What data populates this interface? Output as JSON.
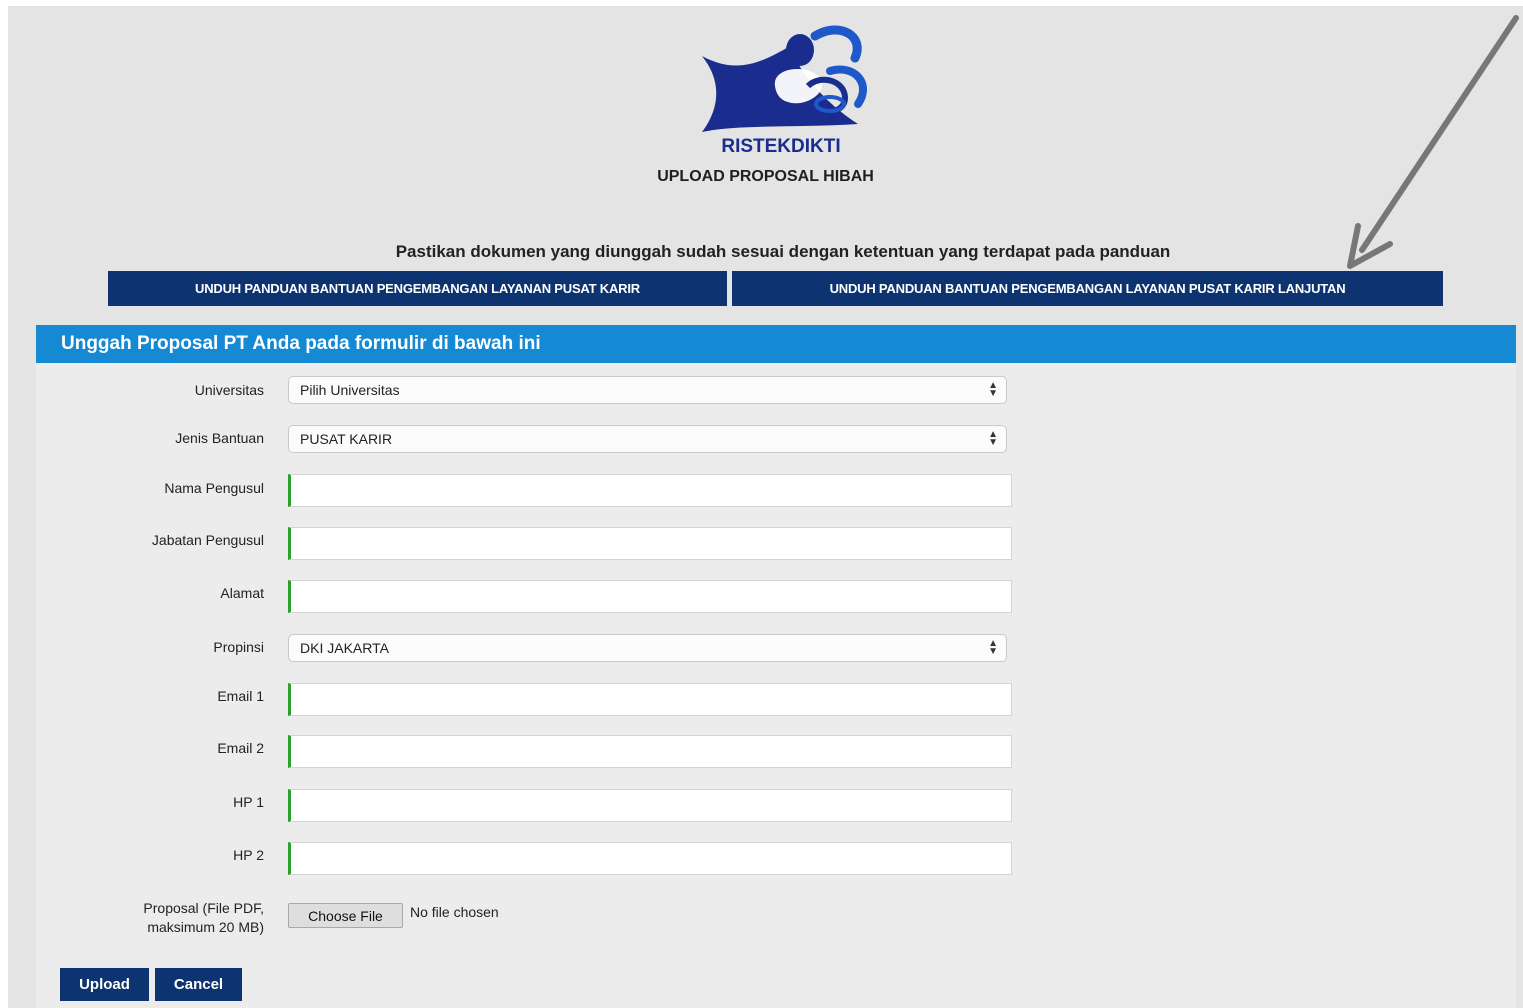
{
  "brand": {
    "name": "RISTEKDIKTI"
  },
  "page": {
    "title": "UPLOAD PROPOSAL HIBAH",
    "notice": "Pastikan dokumen yang diunggah sudah sesuai dengan ketentuan yang terdapat pada panduan"
  },
  "downloads": [
    {
      "label": "UNDUH PANDUAN BANTUAN PENGEMBANGAN LAYANAN PUSAT KARIR"
    },
    {
      "label": "UNDUH PANDUAN BANTUAN PENGEMBANGAN LAYANAN PUSAT KARIR LANJUTAN"
    }
  ],
  "panel": {
    "title": "Unggah Proposal PT Anda pada formulir di bawah ini"
  },
  "form": {
    "universitas": {
      "label": "Universitas",
      "value": "Pilih Universitas"
    },
    "jenis_bantuan": {
      "label": "Jenis Bantuan",
      "value": "PUSAT KARIR"
    },
    "nama_pengusul": {
      "label": "Nama Pengusul",
      "value": ""
    },
    "jabatan_pengusul": {
      "label": "Jabatan Pengusul",
      "value": ""
    },
    "alamat": {
      "label": "Alamat",
      "value": ""
    },
    "propinsi": {
      "label": "Propinsi",
      "value": "DKI JAKARTA"
    },
    "email1": {
      "label": "Email 1",
      "value": ""
    },
    "email2": {
      "label": "Email 2",
      "value": ""
    },
    "hp1": {
      "label": "HP 1",
      "value": ""
    },
    "hp2": {
      "label": "HP 2",
      "value": ""
    },
    "proposal": {
      "label_line1": "Proposal (File PDF,",
      "label_line2": "maksimum 20 MB)",
      "button": "Choose File",
      "status": "No file chosen"
    }
  },
  "actions": {
    "upload": "Upload",
    "cancel": "Cancel"
  },
  "colors": {
    "navy_button": "#0d3470",
    "panel_header": "#1589d4",
    "input_accent": "#2ca02c",
    "logo_blue": "#1a2d8f"
  },
  "icons": {
    "select_arrow": "updown-arrow-icon",
    "annotation": "annotation-arrow-icon"
  }
}
